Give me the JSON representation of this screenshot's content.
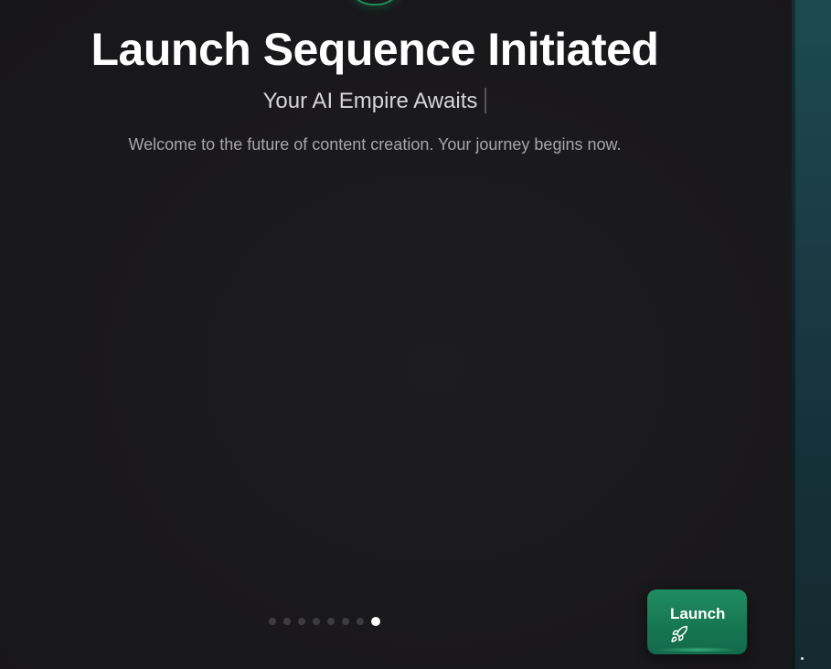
{
  "header": {
    "title": "Launch Sequence Initiated",
    "subtitle": "Your AI Empire Awaits",
    "description": "Welcome to the future of content creation. Your journey begins now."
  },
  "pagination": {
    "total_steps": 8,
    "active_step": 8
  },
  "actions": {
    "launch_label": "Launch",
    "launch_icon": "rocket-icon"
  },
  "colors": {
    "background": "#1a191b",
    "accent": "#1f8d63",
    "side_panel": "#1a3a44"
  }
}
